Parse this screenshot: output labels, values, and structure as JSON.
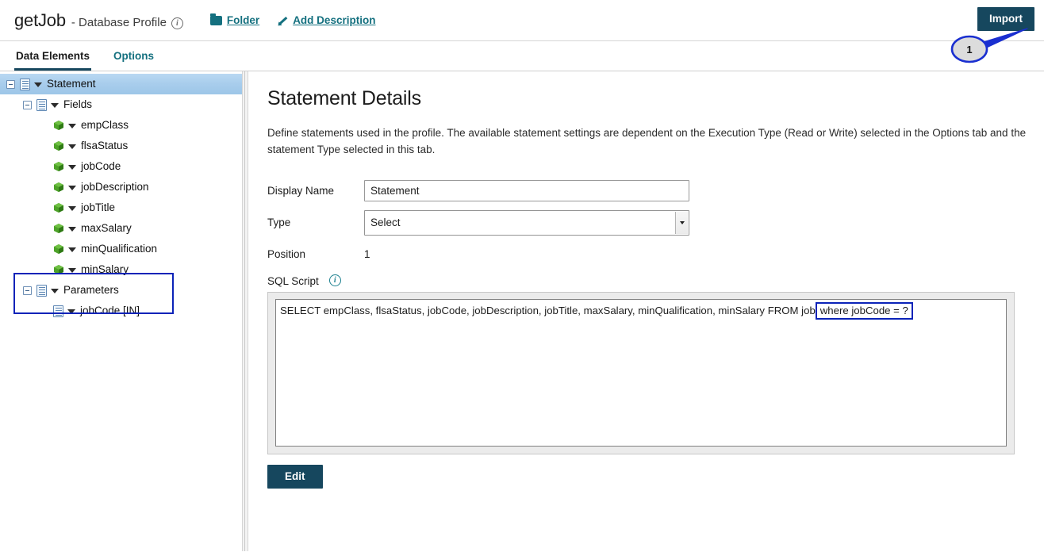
{
  "header": {
    "app_name": "getJob",
    "subtitle": "- Database Profile",
    "info_icon": "info-icon",
    "links": [
      {
        "label": "Folder",
        "icon": "folder-icon"
      },
      {
        "label": "Add Description",
        "icon": "pencil-icon"
      }
    ],
    "import_button": "Import",
    "callout_number": "1"
  },
  "tabs": [
    {
      "label": "Data Elements",
      "active": true
    },
    {
      "label": "Options",
      "active": false
    }
  ],
  "tree": {
    "nodes": [
      {
        "label": "Statement",
        "depth": 0,
        "icon": "document-icon",
        "expander": true,
        "selected": true
      },
      {
        "label": "Fields",
        "depth": 1,
        "icon": "document-icon",
        "expander": true,
        "selected": false
      },
      {
        "label": "empClass",
        "depth": 2,
        "icon": "cube-icon",
        "expander": false,
        "selected": false
      },
      {
        "label": "flsaStatus",
        "depth": 2,
        "icon": "cube-icon",
        "expander": false,
        "selected": false
      },
      {
        "label": "jobCode",
        "depth": 2,
        "icon": "cube-icon",
        "expander": false,
        "selected": false
      },
      {
        "label": "jobDescription",
        "depth": 2,
        "icon": "cube-icon",
        "expander": false,
        "selected": false
      },
      {
        "label": "jobTitle",
        "depth": 2,
        "icon": "cube-icon",
        "expander": false,
        "selected": false
      },
      {
        "label": "maxSalary",
        "depth": 2,
        "icon": "cube-icon",
        "expander": false,
        "selected": false
      },
      {
        "label": "minQualification",
        "depth": 2,
        "icon": "cube-icon",
        "expander": false,
        "selected": false
      },
      {
        "label": "minSalary",
        "depth": 2,
        "icon": "cube-icon",
        "expander": false,
        "selected": false
      },
      {
        "label": "Parameters",
        "depth": 1,
        "icon": "document-icon",
        "expander": true,
        "selected": false
      },
      {
        "label": "jobCode [IN]",
        "depth": 2,
        "icon": "document-icon",
        "expander": false,
        "selected": false
      }
    ]
  },
  "main": {
    "title": "Statement Details",
    "description": "Define statements used in the profile. The available statement settings are dependent on the Execution Type (Read or Write) selected in the Options tab and the statement Type selected in this tab.",
    "fields": {
      "display_name_label": "Display Name",
      "display_name_value": "Statement",
      "type_label": "Type",
      "type_value": "Select",
      "position_label": "Position",
      "position_value": "1",
      "sql_label": "SQL Script"
    },
    "sql": {
      "text_before": "SELECT empClass, flsaStatus, jobCode, jobDescription, jobTitle, maxSalary, minQualification, minSalary FROM job",
      "highlighted": "where jobCode = ?"
    },
    "edit_button": "Edit"
  },
  "colors": {
    "accent_teal": "#14707f",
    "button_navy": "#16475e",
    "highlight_blue": "#0b23b8",
    "selection_blue": "#a8cdec"
  }
}
